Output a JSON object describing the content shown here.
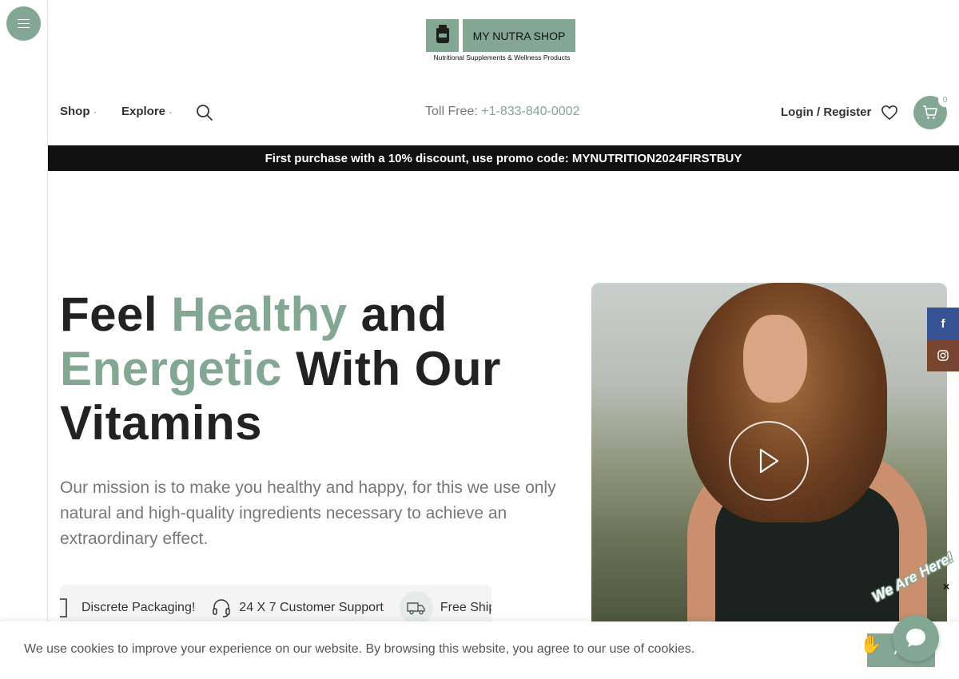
{
  "header": {
    "logo": {
      "name": "MY NUTRA SHOP",
      "tagline": "Nutritional Supplements & Wellness Products"
    },
    "nav": [
      {
        "label": "Shop"
      },
      {
        "label": "Explore"
      }
    ],
    "toll_free": {
      "label": "Toll Free:",
      "phone": "+1-833-840-0002"
    },
    "login_label": "Login / Register",
    "cart_count": "0"
  },
  "promo_bar": "First purchase with a 10% discount, use promo code: MYNUTRITION2024FIRSTBUY",
  "hero": {
    "title_parts": [
      "Feel ",
      "Healthy",
      " and ",
      "Energetic",
      " With Our Vitamins"
    ],
    "description": "Our mission is to make you healthy and happy, for this we use only natural and high-quality ingredients necessary to achieve an extraordinary effect.",
    "features": [
      {
        "icon": "package-icon",
        "label": "Discrete Packaging!"
      },
      {
        "icon": "headset-icon",
        "label": "24 X 7 Customer Support"
      },
      {
        "icon": "truck-icon",
        "label": "Free Shipping f"
      }
    ]
  },
  "social": [
    {
      "icon": "facebook-icon",
      "glyph": "f"
    },
    {
      "icon": "instagram-icon"
    }
  ],
  "cookie": {
    "text": "We use cookies to improve your experience on our website. By browsing this website, you agree to our use of cookies.",
    "accept_label": "Ac"
  },
  "chat": {
    "badge": "We Are Here!",
    "close": "×"
  },
  "colors": {
    "accent": "#84a794",
    "promo_bg": "#111111",
    "facebook": "#365493",
    "instagram": "#774430"
  }
}
